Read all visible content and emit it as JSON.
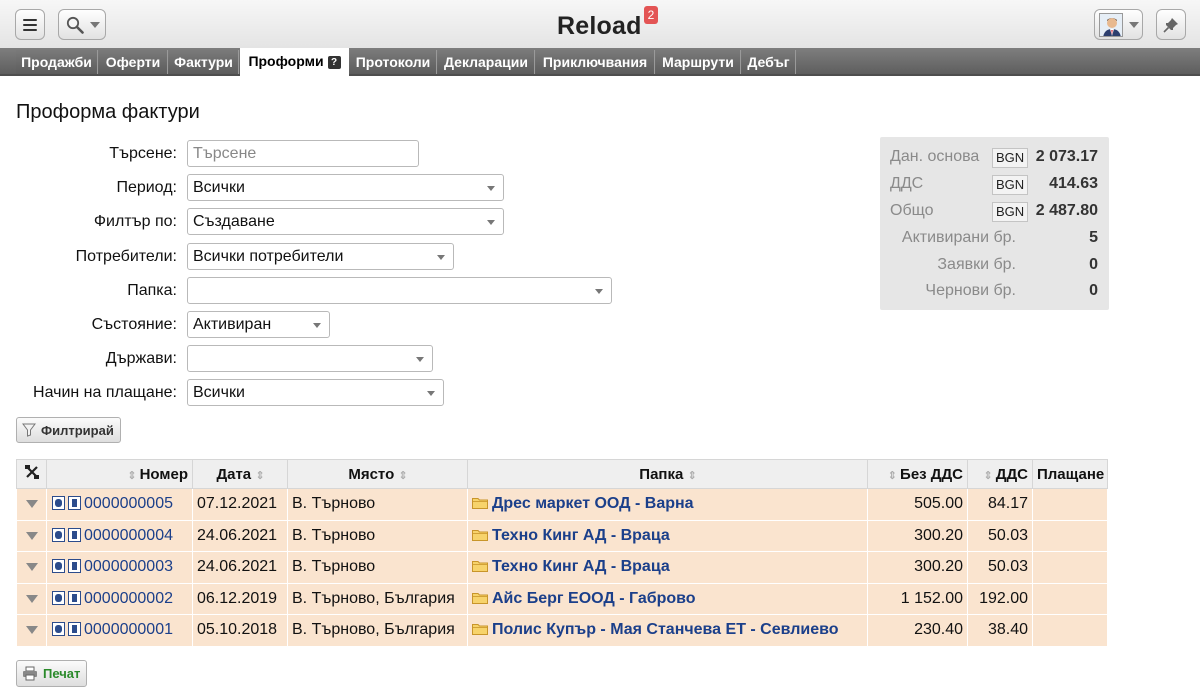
{
  "app": {
    "title": "Reload",
    "notifications": "2"
  },
  "topbar_icons": {
    "menu": "hamburger-icon",
    "search": "magnifier-icon",
    "pin": "pushpin-icon"
  },
  "tabs": [
    {
      "label": "Продажби"
    },
    {
      "label": "Оферти"
    },
    {
      "label": "Фактури"
    },
    {
      "label": "Проформи",
      "active": true
    },
    {
      "label": "Протоколи"
    },
    {
      "label": "Декларации"
    },
    {
      "label": "Приключвания"
    },
    {
      "label": "Маршрути"
    },
    {
      "label": "Дебъг"
    }
  ],
  "page": {
    "title": "Проформа фактури"
  },
  "filters": {
    "search": {
      "label": "Търсене:",
      "placeholder": "Търсене",
      "value": ""
    },
    "period": {
      "label": "Период:",
      "value": "Всички"
    },
    "filter_by": {
      "label": "Филтър по:",
      "value": "Създаване"
    },
    "users": {
      "label": "Потребители:",
      "value": "Всички потребители"
    },
    "folder": {
      "label": "Папка:",
      "value": ""
    },
    "state": {
      "label": "Състояние:",
      "value": "Активиран"
    },
    "countries": {
      "label": "Държави:",
      "value": ""
    },
    "payment": {
      "label": "Начин на плащане:",
      "value": "Всички"
    },
    "filter_button": "Филтрирай"
  },
  "summary": {
    "base": {
      "label": "Дан. основа",
      "currency": "BGN",
      "value": "2 073.17"
    },
    "vat": {
      "label": "ДДС",
      "currency": "BGN",
      "value": "414.63"
    },
    "total": {
      "label": "Общо",
      "currency": "BGN",
      "value": "2 487.80"
    },
    "activated": {
      "label": "Активирани бр.",
      "value": "5"
    },
    "requests": {
      "label": "Заявки бр.",
      "value": "0"
    },
    "drafts": {
      "label": "Чернови бр.",
      "value": "0"
    }
  },
  "table": {
    "headers": {
      "number": "Номер",
      "date": "Дата",
      "place": "Място",
      "folder": "Папка",
      "net": "Без ДДС",
      "vat": "ДДС",
      "payment": "Плащане"
    },
    "rows": [
      {
        "number": "0000000005",
        "date": "07.12.2021",
        "place": "В. Търново",
        "folder": "Дрес маркет ООД - Варна",
        "net": "505.00",
        "vat": "84.17",
        "payment": ""
      },
      {
        "number": "0000000004",
        "date": "24.06.2021",
        "place": "В. Търново",
        "folder": "Техно Кинг АД - Враца",
        "net": "300.20",
        "vat": "50.03",
        "payment": ""
      },
      {
        "number": "0000000003",
        "date": "24.06.2021",
        "place": "В. Търново",
        "folder": "Техно Кинг АД - Враца",
        "net": "300.20",
        "vat": "50.03",
        "payment": ""
      },
      {
        "number": "0000000002",
        "date": "06.12.2019",
        "place": "В. Търново, България",
        "folder": "Айс Берг ЕООД - Габрово",
        "net": "1 152.00",
        "vat": "192.00",
        "payment": ""
      },
      {
        "number": "0000000001",
        "date": "05.10.2018",
        "place": "В. Търново, България",
        "folder": "Полис Купър - Мая Станчева ЕТ - Севлиево",
        "net": "230.40",
        "vat": "38.40",
        "payment": ""
      }
    ]
  },
  "print_button": "Печат",
  "colors": {
    "row_bg": "#fae4cf",
    "link": "#1b3f8a",
    "badge": "#e35454",
    "tabs_bg": "#6a6a6a",
    "print_text": "#2a8a2a"
  }
}
